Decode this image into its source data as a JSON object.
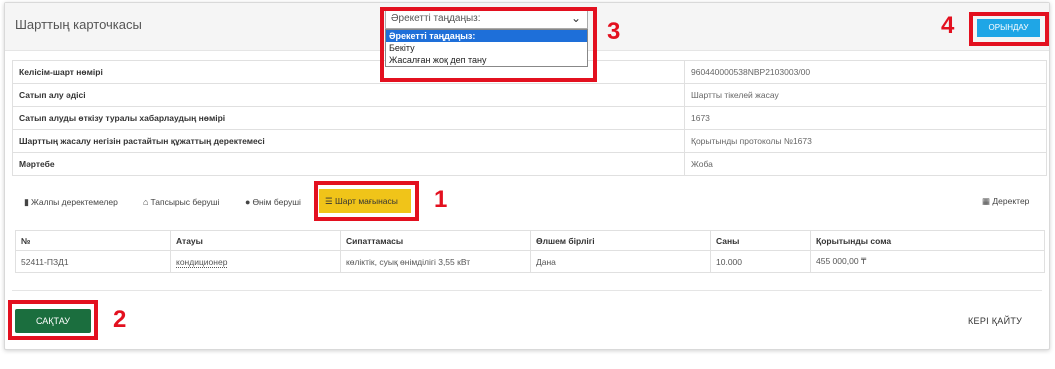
{
  "header": {
    "title": "Шарттың карточкасы",
    "action_select": {
      "value": "Әрекетті таңдаңыз:",
      "options": [
        "Әрекетті таңдаңыз:",
        "Бекіту",
        "Жасалған жоқ деп тану"
      ]
    },
    "execute_label": "ОРЫНДАУ"
  },
  "info": {
    "rows": [
      {
        "label": "Келісім-шарт нөмірі",
        "value": "960440000538NBP2103003/00"
      },
      {
        "label": "Сатып алу әдісі",
        "value": "Шартты тікелей жасау"
      },
      {
        "label": "Сатып алуды өткізу туралы хабарлаудың нөмірі",
        "value": "1673"
      },
      {
        "label": "Шарттың жасалу негізін растайтын құжаттың деректемесі",
        "value": "Қорытынды протоколы №1673"
      },
      {
        "label": "Мәртебе",
        "value": "Жоба"
      }
    ]
  },
  "tabs": {
    "general": "Жалпы деректемелер",
    "customer": "Тапсырыс беруші",
    "supplier": "Өнім беруші",
    "subject": "Шарт мағынасы",
    "data": "Деректер"
  },
  "items_table": {
    "headers": [
      "№",
      "Атауы",
      "Сипаттамасы",
      "Өлшем бірлігі",
      "Саны",
      "Қорытынды сома"
    ],
    "rows": [
      [
        "52411-ПЗД1",
        "кондиционер",
        "көліктік, суық өнімділігі 3,55 кВт",
        "Дана",
        "10.000",
        "455 000,00 ₸"
      ]
    ]
  },
  "footer": {
    "save_label": "САҚТАУ",
    "back_label": "КЕРІ ҚАЙТУ"
  },
  "annotations": [
    "1",
    "2",
    "3",
    "4"
  ],
  "colors": {
    "highlight": "#e3101f",
    "execute": "#1fa6e6",
    "save": "#1b6e3e",
    "active_tab": "#f0c419"
  }
}
